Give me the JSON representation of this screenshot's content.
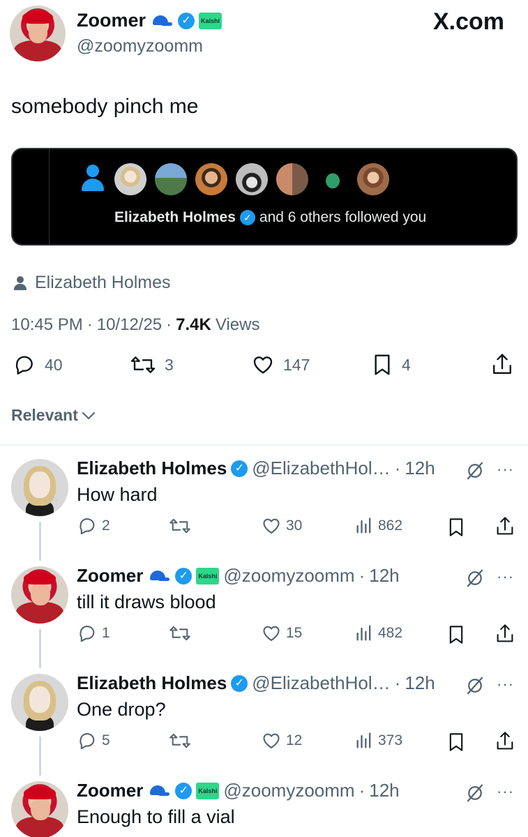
{
  "header": {
    "display_name": "Zoomer",
    "handle": "@zoomyzoomm",
    "kalshi_label": "Kalshi",
    "site_label": "X.com"
  },
  "post": {
    "text": "somebody pinch me",
    "notification": {
      "name": "Elizabeth Holmes",
      "rest": "and 6 others followed you",
      "avatars": [
        "person-icon",
        "woman",
        "landscape",
        "man-glasses",
        "man-hat",
        "couple",
        "chameleon",
        "woman-2"
      ]
    },
    "tagged_user": "Elizabeth Holmes",
    "time": "10:45 PM",
    "date": "10/12/25",
    "views_count": "7.4K",
    "views_label": "Views",
    "separator": "·",
    "stats": {
      "replies": "40",
      "reposts": "3",
      "likes": "147",
      "bookmarks": "4"
    }
  },
  "sort": {
    "label": "Relevant"
  },
  "replies": [
    {
      "name": "Elizabeth Holmes",
      "handle": "@ElizabethHol…",
      "time": "12h",
      "text": "How hard",
      "replies": "2",
      "reposts": "",
      "likes": "30",
      "views": "862"
    },
    {
      "name": "Zoomer",
      "handle": "@zoomyzoomm",
      "time": "12h",
      "text": "till it draws blood",
      "replies": "1",
      "reposts": "",
      "likes": "15",
      "views": "482"
    },
    {
      "name": "Elizabeth Holmes",
      "handle": "@ElizabethHol…",
      "time": "12h",
      "text": "One drop?",
      "replies": "5",
      "reposts": "",
      "likes": "12",
      "views": "373"
    },
    {
      "name": "Zoomer",
      "handle": "@zoomyzoomm",
      "time": "12h",
      "text": "Enough to fill a vial"
    }
  ],
  "colors": {
    "accent": "#1d9bf0",
    "text": "#0f1419",
    "secondary": "#536471",
    "card_bg": "#000000"
  }
}
